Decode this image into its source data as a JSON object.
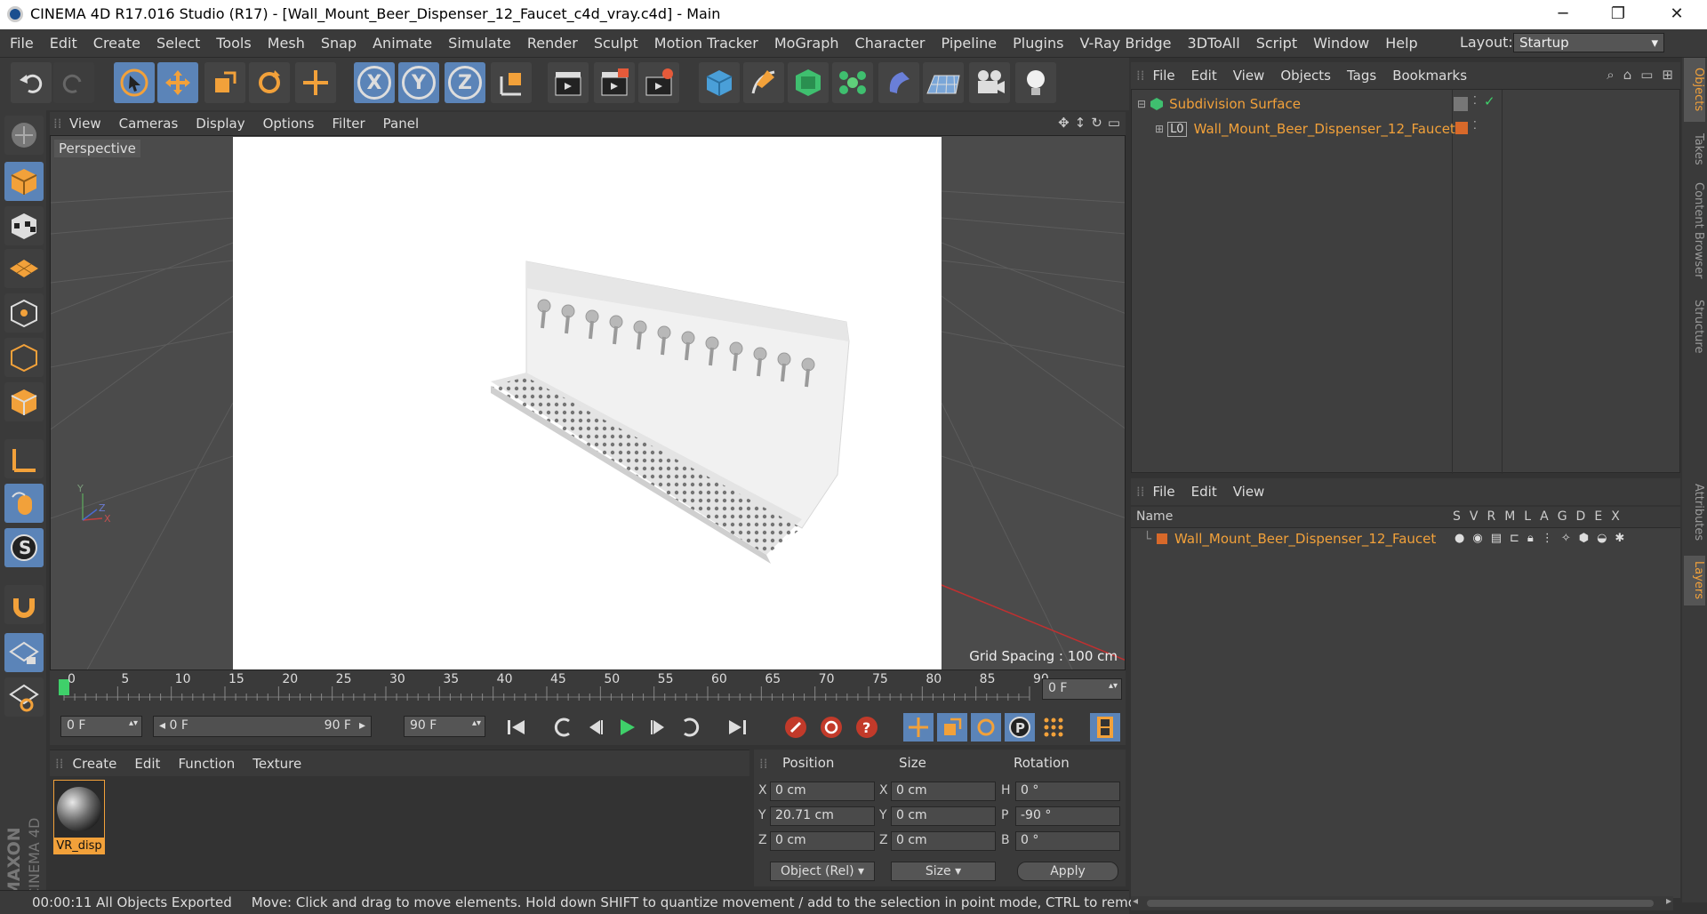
{
  "window": {
    "title": "CINEMA 4D R17.016 Studio (R17) - [Wall_Mount_Beer_Dispenser_12_Faucet_c4d_vray.c4d] - Main",
    "minimize": "─",
    "maximize": "❐",
    "close": "✕"
  },
  "menubar": {
    "items": [
      "File",
      "Edit",
      "Create",
      "Select",
      "Tools",
      "Mesh",
      "Snap",
      "Animate",
      "Simulate",
      "Render",
      "Sculpt",
      "Motion Tracker",
      "MoGraph",
      "Character",
      "Pipeline",
      "Plugins",
      "V-Ray Bridge",
      "3DToAll",
      "Script",
      "Window",
      "Help"
    ],
    "layout_label": "Layout:",
    "layout_value": "Startup"
  },
  "toolbar": {
    "axis_x": "X",
    "axis_y": "Y",
    "axis_z": "Z"
  },
  "viewport": {
    "menu": [
      "View",
      "Cameras",
      "Display",
      "Options",
      "Filter",
      "Panel"
    ],
    "label": "Perspective",
    "grid_spacing": "Grid Spacing : 100 cm",
    "axis_y": "Y",
    "axis_z": "Z",
    "axis_x": "X"
  },
  "timeline": {
    "ticks": [
      "0",
      "5",
      "10",
      "15",
      "20",
      "25",
      "30",
      "35",
      "40",
      "45",
      "50",
      "55",
      "60",
      "65",
      "70",
      "75",
      "80",
      "85",
      "90"
    ],
    "current_frame": "0 F",
    "start_field": "0 F",
    "range_start": "0 F",
    "range_end": "90 F",
    "end_field": "90 F",
    "playhead_fraction": 0
  },
  "material_manager": {
    "menu": [
      "Create",
      "Edit",
      "Function",
      "Texture"
    ],
    "materials": [
      {
        "name": "VR_disp"
      }
    ]
  },
  "coordinates": {
    "headers": {
      "position": "Position",
      "size": "Size",
      "rotation": "Rotation"
    },
    "rows": [
      {
        "pos_label": "X",
        "pos": "0 cm",
        "size_label": "X",
        "size": "0 cm",
        "rot_label": "H",
        "rot": "0 °"
      },
      {
        "pos_label": "Y",
        "pos": "20.71 cm",
        "size_label": "Y",
        "size": "0 cm",
        "rot_label": "P",
        "rot": "-90 °"
      },
      {
        "pos_label": "Z",
        "pos": "0 cm",
        "size_label": "Z",
        "size": "0 cm",
        "rot_label": "B",
        "rot": "0 °"
      }
    ],
    "mode": "Object (Rel)",
    "size_mode": "Size",
    "apply": "Apply"
  },
  "object_manager": {
    "menu": [
      "File",
      "Edit",
      "View",
      "Objects",
      "Tags",
      "Bookmarks"
    ],
    "objects": [
      {
        "name": "Subdivision Surface"
      },
      {
        "name": "Wall_Mount_Beer_Dispenser_12_Faucet"
      }
    ]
  },
  "layer_manager": {
    "menu": [
      "File",
      "Edit",
      "View"
    ],
    "col_name": "Name",
    "cols": [
      "S",
      "V",
      "R",
      "M",
      "L",
      "A",
      "G",
      "D",
      "E",
      "X"
    ],
    "layers": [
      {
        "name": "Wall_Mount_Beer_Dispenser_12_Faucet"
      }
    ]
  },
  "side_tabs": [
    "Objects",
    "Takes",
    "Content Browser",
    "Structure",
    "Attributes",
    "Layers"
  ],
  "branding": {
    "text": "MAXON CINEMA 4D"
  },
  "status": {
    "time": "00:00:11 All Objects Exported",
    "hint": "Move: Click and drag to move elements. Hold down SHIFT to quantize movement / add to the selection in point mode, CTRL to remove."
  },
  "colors": {
    "accent": "#f2a13a",
    "selected": "#5b84b8",
    "panel": "#3a3a3a"
  }
}
